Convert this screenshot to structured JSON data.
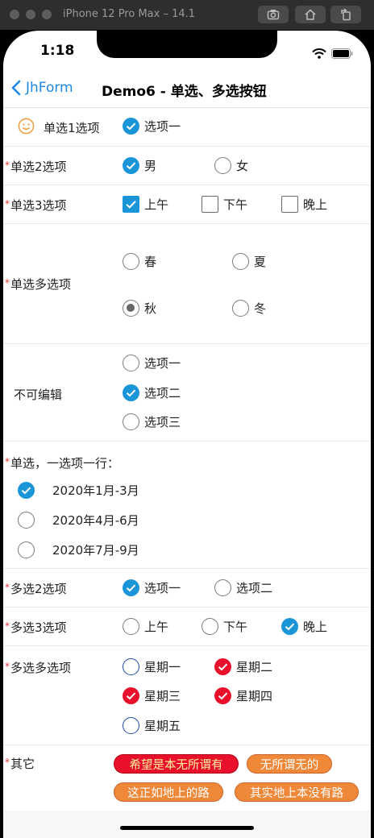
{
  "simulator": {
    "title": "iPhone 12 Pro Max – 14.1"
  },
  "status": {
    "time": "1:18"
  },
  "nav": {
    "back": "JhForm",
    "title": "Demo6 - 单选、多选按钮"
  },
  "rows": {
    "r1": {
      "label": "单选1选项",
      "options": [
        "选项一"
      ]
    },
    "r2": {
      "label": "单选2选项",
      "options": [
        "男",
        "女"
      ]
    },
    "r3": {
      "label": "单选3选项",
      "options": [
        "上午",
        "下午",
        "晚上"
      ]
    },
    "r4": {
      "label": "单选多选项",
      "options": [
        "春",
        "夏",
        "秋",
        "冬"
      ]
    },
    "r5": {
      "label": "不可编辑",
      "options": [
        "选项一",
        "选项二",
        "选项三"
      ]
    },
    "r6": {
      "label": "单选，一选项一行：",
      "options": [
        "2020年1月-3月",
        "2020年4月-6月",
        "2020年7月-9月"
      ]
    },
    "r7": {
      "label": "多选2选项",
      "options": [
        "选项一",
        "选项二"
      ]
    },
    "r8": {
      "label": "多选3选项",
      "options": [
        "上午",
        "下午",
        "晚上"
      ]
    },
    "r9": {
      "label": "多选多选项",
      "options": [
        "星期一",
        "星期二",
        "星期三",
        "星期四",
        "星期五"
      ]
    },
    "r10": {
      "label": "其它",
      "tags": [
        "希望是本无所谓有",
        "无所谓无的",
        "这正如地上的路",
        "其实地上本没有路"
      ]
    }
  },
  "required_mark": "*",
  "colors": {
    "accent": "#1a95d8",
    "red_check": "#e8102a",
    "tag_orange": "#f0883a",
    "nav_blue": "#1e88e5"
  }
}
